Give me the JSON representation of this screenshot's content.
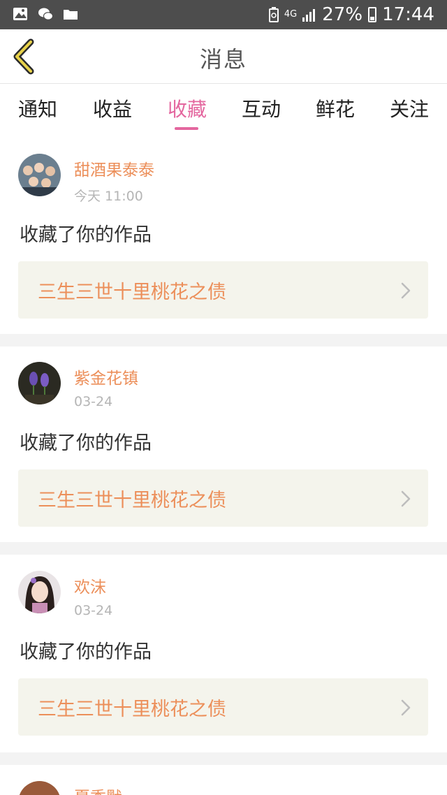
{
  "status_bar": {
    "network": "4G",
    "battery": "27%",
    "time": "17:44",
    "icons": [
      "gallery-icon",
      "wechat-icon",
      "folder-icon",
      "recycle-icon",
      "signal-icon",
      "battery-icon"
    ]
  },
  "header": {
    "title": "消息",
    "back_icon": "chevron-left-icon"
  },
  "tabs": [
    {
      "label": "通知",
      "active": false
    },
    {
      "label": "收益",
      "active": false
    },
    {
      "label": "收藏",
      "active": true
    },
    {
      "label": "互动",
      "active": false
    },
    {
      "label": "鲜花",
      "active": false
    },
    {
      "label": "关注",
      "active": false
    }
  ],
  "messages": [
    {
      "user": "甜酒果泰泰",
      "time": "今天 11:00",
      "action": "收藏了你的作品",
      "work_title": "三生三世十里桃花之债"
    },
    {
      "user": "紫金花镇",
      "time": "03-24",
      "action": "收藏了你的作品",
      "work_title": "三生三世十里桃花之债"
    },
    {
      "user": "欢沫",
      "time": "03-24",
      "action": "收藏了你的作品",
      "work_title": "三生三世十里桃花之债"
    }
  ],
  "partial_message": {
    "user": "夏季默"
  },
  "colors": {
    "accent": "#e4679f",
    "orange": "#ec8f5a",
    "status_bar": "#4d4d4d",
    "card_bg": "#f4f4ec",
    "separator": "#f3f3f3"
  }
}
